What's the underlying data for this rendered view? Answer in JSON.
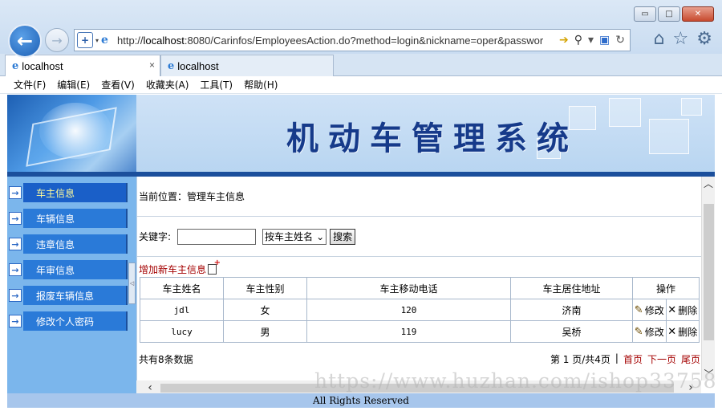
{
  "browser": {
    "window_buttons": {
      "minimize": "▭",
      "maximize": "□",
      "close": "✕"
    },
    "address": {
      "url_prefix": "http://",
      "url_host": "localhost",
      "url_rest": ":8080/Carinfos/EmployeesAction.do?method=login&nickname=oper&passwor"
    },
    "tabs": [
      {
        "label": "localhost",
        "close": "×"
      },
      {
        "label": "localhost"
      }
    ],
    "menu": [
      "文件(F)",
      "编辑(E)",
      "查看(V)",
      "收藏夹(A)",
      "工具(T)",
      "帮助(H)"
    ]
  },
  "banner": {
    "title": "机动车管理系统"
  },
  "sidebar": {
    "items": [
      {
        "label": "车主信息",
        "active": true
      },
      {
        "label": "车辆信息"
      },
      {
        "label": "违章信息"
      },
      {
        "label": "年审信息"
      },
      {
        "label": "报废车辆信息"
      },
      {
        "label": "修改个人密码"
      }
    ]
  },
  "content": {
    "breadcrumb": "当前位置：管理车主信息",
    "search": {
      "label": "关键字:",
      "value": "",
      "select_value": "按车主姓名",
      "button": "搜索"
    },
    "add_link": "增加新车主信息",
    "table": {
      "headers": [
        "车主姓名",
        "车主性别",
        "车主移动电话",
        "车主居住地址",
        "操作"
      ],
      "rows": [
        {
          "name": "jdl",
          "gender": "女",
          "phone": "120",
          "address": "济南",
          "edit": "修改",
          "delete": "删除"
        },
        {
          "name": "lucy",
          "gender": "男",
          "phone": "119",
          "address": "吴桥",
          "edit": "修改",
          "delete": "删除"
        }
      ]
    },
    "footer": {
      "total": "共有8条数据",
      "page_info": "第 1 页/共4页",
      "separator": "|",
      "first": "首页",
      "next": "下一页",
      "last": "尾页"
    }
  },
  "copyright": "All Rights Reserved",
  "watermark": "https://www.huzhan.com/ishop33758"
}
